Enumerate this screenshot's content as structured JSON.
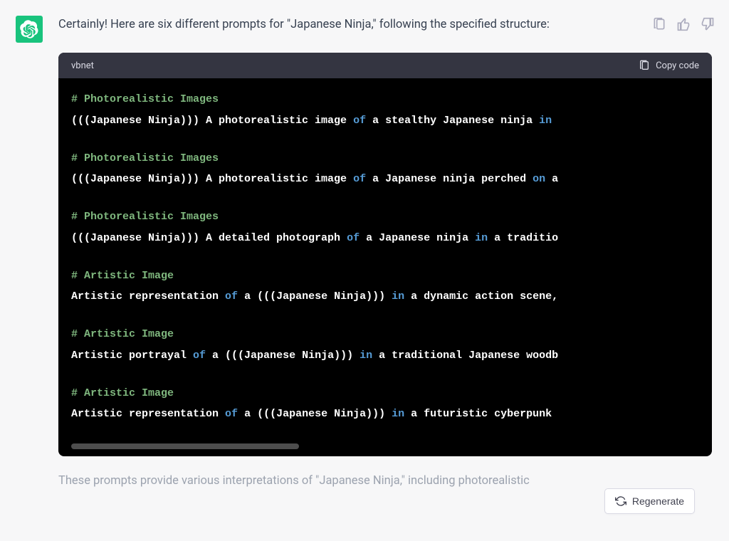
{
  "message": {
    "intro": "Certainly! Here are six different prompts for \"Japanese Ninja,\" following the specified structure:",
    "outro": "These prompts provide various interpretations of \"Japanese Ninja,\" including photorealistic"
  },
  "code": {
    "language": "vbnet",
    "copy_label": "Copy code",
    "blocks": [
      {
        "comment": "# Photorealistic Images",
        "parts": [
          "(((Japanese Ninja))) A photorealistic image ",
          "of",
          " a stealthy Japanese ninja ",
          "in",
          " "
        ]
      },
      {
        "comment": "# Photorealistic Images",
        "parts": [
          "(((Japanese Ninja))) A photorealistic image ",
          "of",
          " a Japanese ninja perched ",
          "on",
          " a"
        ]
      },
      {
        "comment": "# Photorealistic Images",
        "parts": [
          "(((Japanese Ninja))) A detailed photograph ",
          "of",
          " a Japanese ninja ",
          "in",
          " a traditio"
        ]
      },
      {
        "comment": "# Artistic Image",
        "parts": [
          "Artistic representation ",
          "of",
          " a (((Japanese Ninja))) ",
          "in",
          " a dynamic action scene,"
        ]
      },
      {
        "comment": "# Artistic Image",
        "parts": [
          "Artistic portrayal ",
          "of",
          " a (((Japanese Ninja))) ",
          "in",
          " a traditional Japanese woodb"
        ]
      },
      {
        "comment": "# Artistic Image",
        "parts": [
          "Artistic representation ",
          "of",
          " a (((Japanese Ninja))) ",
          "in",
          " a futuristic cyberpunk "
        ]
      }
    ]
  },
  "actions": {
    "regenerate": "Regenerate"
  }
}
